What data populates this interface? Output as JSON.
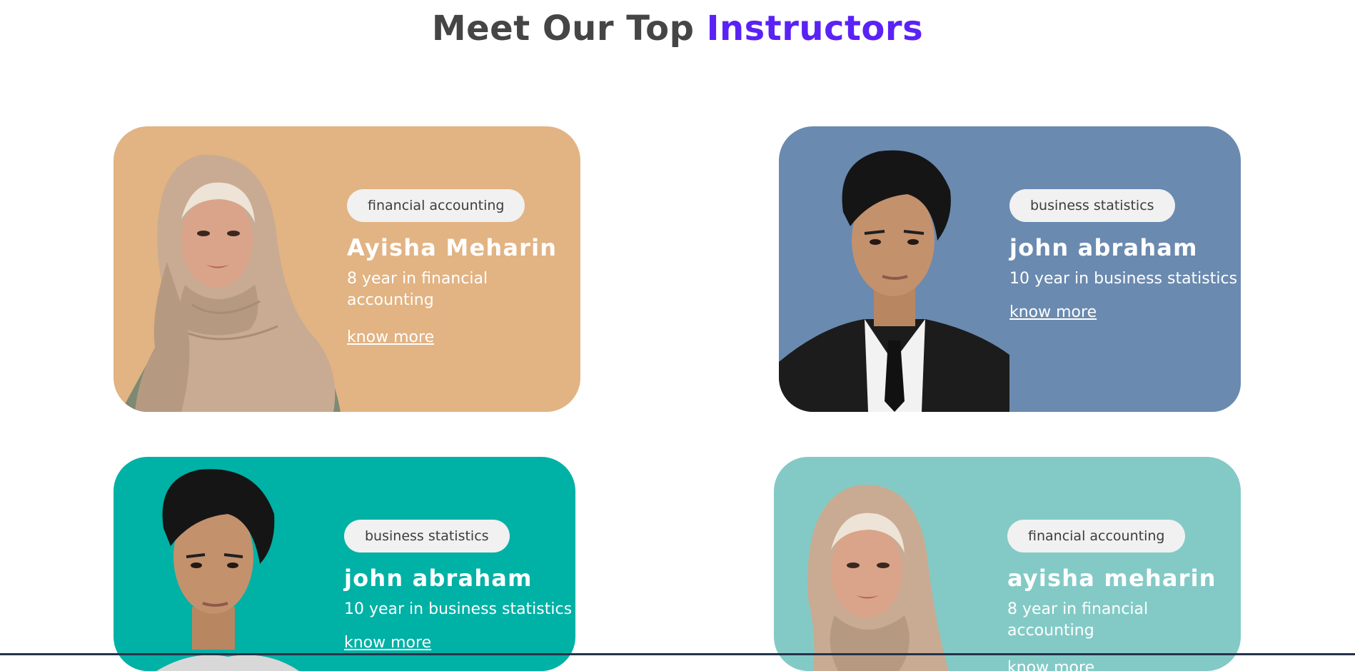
{
  "heading": {
    "part1": "Meet Our Top ",
    "part2": "Instructors",
    "accent_color": "#5a22f5"
  },
  "instructors": [
    {
      "tag": "financial accounting",
      "name": "Ayisha Meharin",
      "experience": "8 year in financial accounting",
      "link": "know more",
      "bg_color": "#e2b383",
      "photo": "woman-in-hijab-portrait"
    },
    {
      "tag": "business statistics",
      "name": "john abraham",
      "experience": "10 year in business statistics",
      "link": "know more",
      "bg_color": "#6a8ab0",
      "photo": "man-in-suit-portrait"
    },
    {
      "tag": "business statistics",
      "name": "john abraham",
      "experience": "10 year in business statistics",
      "link": "know more",
      "bg_color": "#00b1a5",
      "photo": "man-portrait"
    },
    {
      "tag": "financial accounting",
      "name": "ayisha meharin",
      "experience": "8 year in financial accounting",
      "link": "know more",
      "bg_color": "#83cac6",
      "photo": "woman-in-hijab-portrait"
    }
  ]
}
